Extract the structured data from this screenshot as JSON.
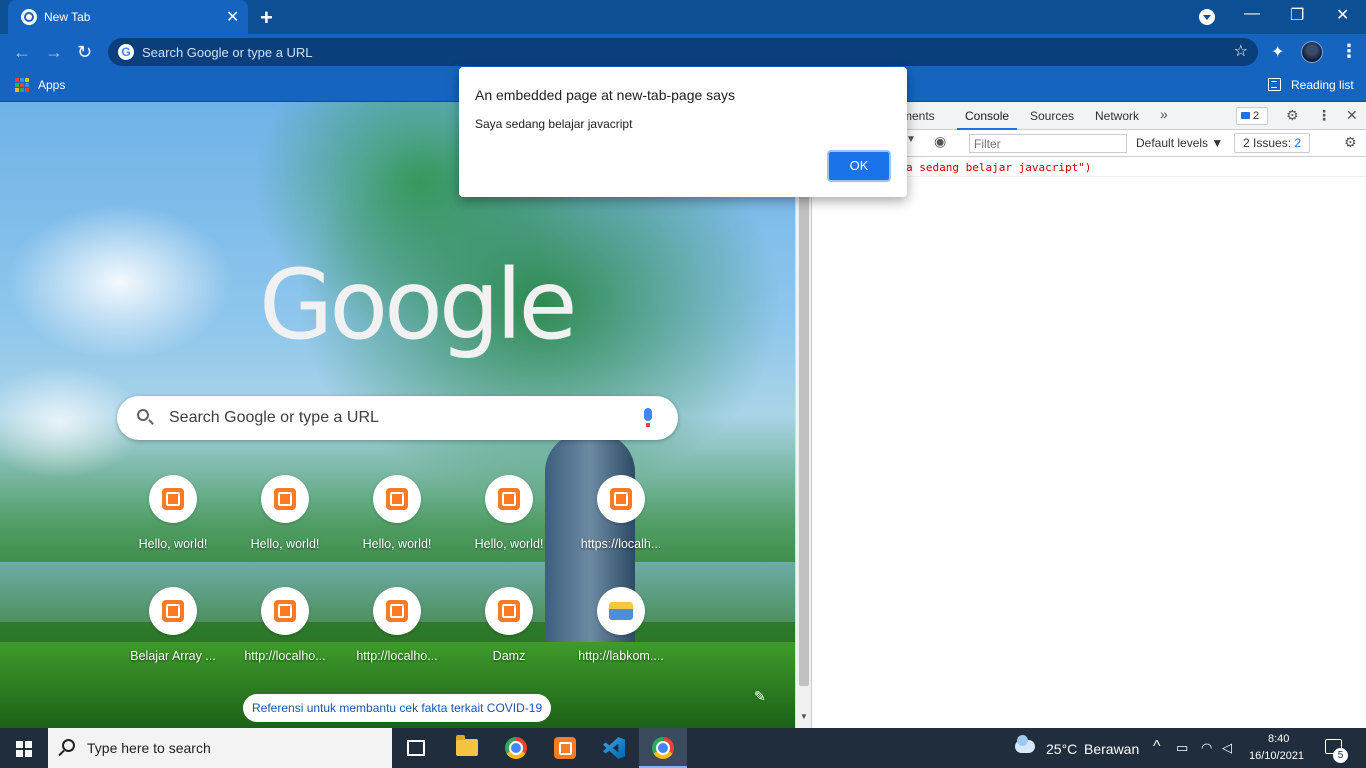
{
  "browser": {
    "tab_title": "New Tab",
    "tab_close": "✕",
    "new_tab": "+",
    "omnibox_placeholder": "Search Google or type a URL",
    "back": "←",
    "forward": "→",
    "reload": "↻",
    "star": "☆",
    "extensions": "✦",
    "menu": "⋮",
    "window_min": "—",
    "window_restore": "❐",
    "window_close": "✕",
    "bookmarks": {
      "apps_label": "Apps",
      "reading_list_label": "Reading list"
    }
  },
  "ntp": {
    "logo_text": "Google",
    "search_placeholder": "Search Google or type a URL",
    "shortcuts": [
      {
        "label": "Hello, world!",
        "icon": "xampp-icon"
      },
      {
        "label": "Hello, world!",
        "icon": "xampp-icon"
      },
      {
        "label": "Hello, world!",
        "icon": "xampp-icon"
      },
      {
        "label": "Hello, world!",
        "icon": "xampp-icon"
      },
      {
        "label": "https://localh...",
        "icon": "xampp-icon"
      },
      {
        "label": "Belajar Array ...",
        "icon": "xampp-icon"
      },
      {
        "label": "http://localho...",
        "icon": "xampp-icon"
      },
      {
        "label": "http://localho...",
        "icon": "xampp-icon"
      },
      {
        "label": "Damz",
        "icon": "xampp-icon"
      },
      {
        "label": "http://labkom....",
        "icon": "smk-logo-icon"
      }
    ],
    "covid_chip": "Referensi untuk membantu cek fakta terkait COVID-19",
    "customize_icon": "pencil-icon"
  },
  "dialog": {
    "title": "An embedded page at new-tab-page says",
    "message": "Saya sedang belajar javacript",
    "ok_label": "OK"
  },
  "devtools": {
    "tabs": [
      "ments",
      "Console",
      "Sources",
      "Network"
    ],
    "active_tab": "Console",
    "more_tabs": "»",
    "messages_badge": "2",
    "settings": "⚙",
    "kebab": "⋮",
    "close": "✕",
    "filter_placeholder": "Filter",
    "levels_label": "Default levels ▼",
    "issues_label": "2 Issues:",
    "issues_count": "2",
    "console_output": "a sedang belajar javacript\")"
  },
  "taskbar": {
    "search_placeholder": "Type here to search",
    "weather_temp": "25°C",
    "weather_desc": "Berawan",
    "time": "8:40",
    "date": "16/10/2021",
    "notification_count": "5",
    "tray_chevron": "^"
  },
  "colors": {
    "chrome_blue": "#1565c0",
    "titlebar": "#0d4f95",
    "accent": "#1a73e8",
    "taskbar": "#1f2d3d",
    "xampp_orange": "#fb7a24"
  }
}
